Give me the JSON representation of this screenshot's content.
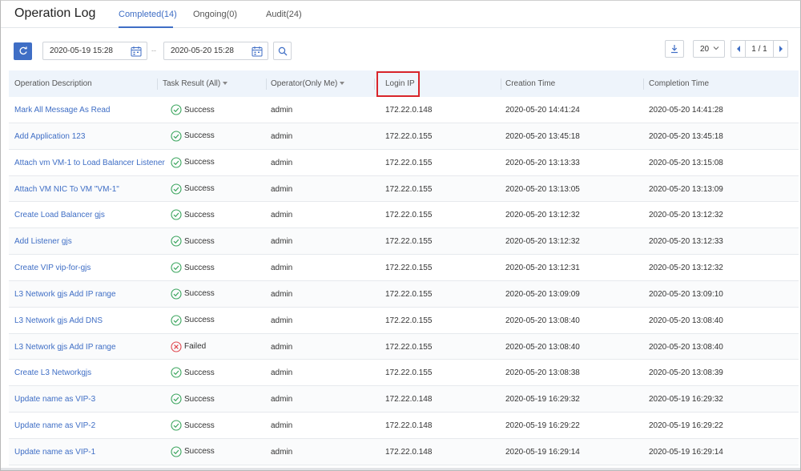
{
  "header": {
    "title": "Operation Log",
    "tabs": [
      {
        "label": "Completed(14)",
        "active": true
      },
      {
        "label": "Ongoing(0)",
        "active": false
      },
      {
        "label": "Audit(24)",
        "active": false
      }
    ]
  },
  "toolbar": {
    "start_date": "2020-05-19 15:28",
    "separator": "--",
    "end_date": "2020-05-20 15:28",
    "page_size": "20",
    "page_info": "1 / 1"
  },
  "colors": {
    "accent": "#3f6ec5",
    "success": "#3aa55d",
    "failed": "#e0484f",
    "highlight": "#d9252b"
  },
  "table": {
    "columns": [
      "Operation Description",
      "Task Result (All)",
      "Operator(Only Me)",
      "Login IP",
      "Creation Time",
      "Completion Time"
    ],
    "rows": [
      {
        "desc": "Mark All Message As Read",
        "result": "Success",
        "status": "success",
        "operator": "admin",
        "ip": "172.22.0.148",
        "created": "2020-05-20 14:41:24",
        "completed": "2020-05-20 14:41:28"
      },
      {
        "desc": "Add Application 123",
        "result": "Success",
        "status": "success",
        "operator": "admin",
        "ip": "172.22.0.155",
        "created": "2020-05-20 13:45:18",
        "completed": "2020-05-20 13:45:18"
      },
      {
        "desc": "Attach vm VM-1 to Load Balancer Listener",
        "result": "Success",
        "status": "success",
        "operator": "admin",
        "ip": "172.22.0.155",
        "created": "2020-05-20 13:13:33",
        "completed": "2020-05-20 13:15:08"
      },
      {
        "desc": "Attach VM NIC To VM \"VM-1\"",
        "result": "Success",
        "status": "success",
        "operator": "admin",
        "ip": "172.22.0.155",
        "created": "2020-05-20 13:13:05",
        "completed": "2020-05-20 13:13:09"
      },
      {
        "desc": "Create Load Balancer gjs",
        "result": "Success",
        "status": "success",
        "operator": "admin",
        "ip": "172.22.0.155",
        "created": "2020-05-20 13:12:32",
        "completed": "2020-05-20 13:12:32"
      },
      {
        "desc": "Add Listener gjs",
        "result": "Success",
        "status": "success",
        "operator": "admin",
        "ip": "172.22.0.155",
        "created": "2020-05-20 13:12:32",
        "completed": "2020-05-20 13:12:33"
      },
      {
        "desc": "Create VIP vip-for-gjs",
        "result": "Success",
        "status": "success",
        "operator": "admin",
        "ip": "172.22.0.155",
        "created": "2020-05-20 13:12:31",
        "completed": "2020-05-20 13:12:32"
      },
      {
        "desc": "L3 Network gjs Add IP range",
        "result": "Success",
        "status": "success",
        "operator": "admin",
        "ip": "172.22.0.155",
        "created": "2020-05-20 13:09:09",
        "completed": "2020-05-20 13:09:10"
      },
      {
        "desc": "L3 Network gjs Add DNS",
        "result": "Success",
        "status": "success",
        "operator": "admin",
        "ip": "172.22.0.155",
        "created": "2020-05-20 13:08:40",
        "completed": "2020-05-20 13:08:40"
      },
      {
        "desc": "L3 Network gjs Add IP range",
        "result": "Failed",
        "status": "failed",
        "operator": "admin",
        "ip": "172.22.0.155",
        "created": "2020-05-20 13:08:40",
        "completed": "2020-05-20 13:08:40"
      },
      {
        "desc": "Create L3 Networkgjs",
        "result": "Success",
        "status": "success",
        "operator": "admin",
        "ip": "172.22.0.155",
        "created": "2020-05-20 13:08:38",
        "completed": "2020-05-20 13:08:39"
      },
      {
        "desc": "Update name as VIP-3",
        "result": "Success",
        "status": "success",
        "operator": "admin",
        "ip": "172.22.0.148",
        "created": "2020-05-19 16:29:32",
        "completed": "2020-05-19 16:29:32"
      },
      {
        "desc": "Update name as VIP-2",
        "result": "Success",
        "status": "success",
        "operator": "admin",
        "ip": "172.22.0.148",
        "created": "2020-05-19 16:29:22",
        "completed": "2020-05-19 16:29:22"
      },
      {
        "desc": "Update name as VIP-1",
        "result": "Success",
        "status": "success",
        "operator": "admin",
        "ip": "172.22.0.148",
        "created": "2020-05-19 16:29:14",
        "completed": "2020-05-19 16:29:14"
      }
    ]
  }
}
